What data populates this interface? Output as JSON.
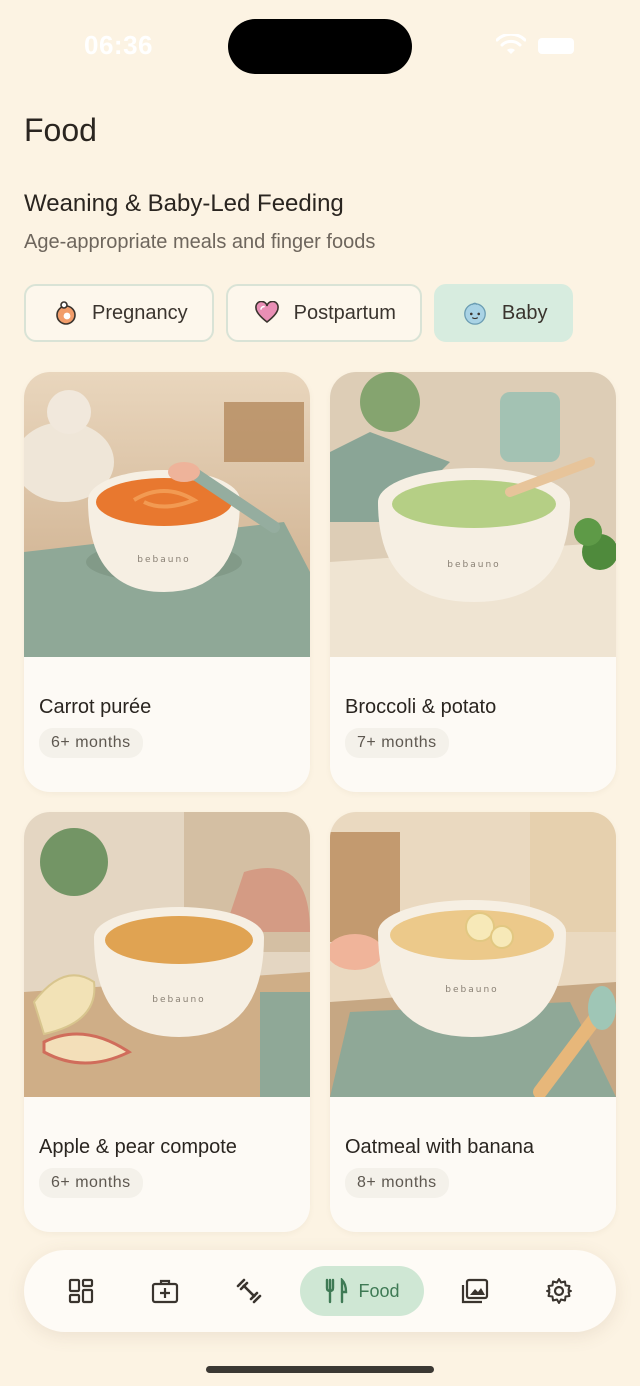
{
  "status_bar": {
    "time": "06:36"
  },
  "page": {
    "title": "Food"
  },
  "section": {
    "title": "Weaning & Baby-Led Feeding",
    "subtitle": "Age-appropriate meals and finger foods"
  },
  "chips": [
    {
      "label": "Pregnancy",
      "icon": "pregnancy-icon",
      "active": false
    },
    {
      "label": "Postpartum",
      "icon": "heart-icon",
      "active": false
    },
    {
      "label": "Baby",
      "icon": "baby-face-icon",
      "active": true
    }
  ],
  "recipes": [
    {
      "title": "Carrot purée",
      "age": "6+ months",
      "bowl_brand": "bebauno"
    },
    {
      "title": "Broccoli & potato",
      "age": "7+ months",
      "bowl_brand": "bebauno"
    },
    {
      "title": "Apple & pear compote",
      "age": "6+ months",
      "bowl_brand": "bebauno"
    },
    {
      "title": "Oatmeal with banana",
      "age": "8+ months",
      "bowl_brand": "bebauno"
    }
  ],
  "bottom_nav": {
    "items": [
      {
        "icon": "dashboard-icon"
      },
      {
        "icon": "medical-kit-icon"
      },
      {
        "icon": "dumbbell-icon"
      },
      {
        "icon": "cutlery-icon",
        "label": "Food",
        "active": true
      },
      {
        "icon": "gallery-icon"
      },
      {
        "icon": "settings-gear-icon"
      }
    ]
  },
  "colors": {
    "background": "#fcf3e3",
    "accent": "#cfe7d4",
    "accent_text": "#3f7a55"
  }
}
